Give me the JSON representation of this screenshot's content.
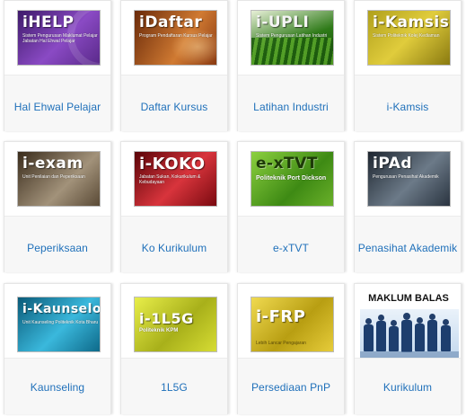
{
  "cards": [
    {
      "label": "Hal Ehwal Pelajar",
      "thumb_title": "iHELP",
      "thumb_sub": "Sistem Pengurusan Maklumat Pelajar Jabatan Hal Ehwal Pelajar",
      "colors": [
        "#5a2a8a",
        "#7d3fb0"
      ]
    },
    {
      "label": "Daftar Kursus",
      "thumb_title": "iDaftar",
      "thumb_sub": "Program Pendaftaran Kursus Pelajar",
      "colors": [
        "#8a3a12",
        "#c46a2a"
      ]
    },
    {
      "label": "Latihan Industri",
      "thumb_title": "i-UPLI",
      "thumb_sub": "Sistem Pengurusan Latihan Industri",
      "colors": [
        "#1f5e12",
        "#4f9a22"
      ]
    },
    {
      "label": "i-Kamsis",
      "thumb_title": "i-Kamsis",
      "thumb_sub": "Sistem Politeknik Kolej Kediaman",
      "colors": [
        "#8a7a10",
        "#c9b42a"
      ]
    },
    {
      "label": "Peperiksaan",
      "thumb_title": "i-exam",
      "thumb_sub": "Unit Penilaian dan Peperiksaan",
      "colors": [
        "#4a3a28",
        "#8a7a62"
      ]
    },
    {
      "label": "Ko Kurikulum",
      "thumb_title": "i-KOKO",
      "thumb_sub": "Jabatan Sukan, Kokurikulum & Kebudayaan",
      "colors": [
        "#7a0a10",
        "#c8242c"
      ]
    },
    {
      "label": "e-xTVT",
      "thumb_title": "e-xTVT",
      "thumb_sub": "Politeknik Port Dickson",
      "colors": [
        "#3e7a14",
        "#7ec23a"
      ]
    },
    {
      "label": "Penasihat Akademik",
      "thumb_title": "iPAd",
      "thumb_sub": "Pengurusan Penasihat Akademik",
      "colors": [
        "#2a3440",
        "#5c6a78"
      ]
    },
    {
      "label": "Kaunseling",
      "thumb_title": "i-Kaunselor",
      "thumb_sub": "Unit Kaunseling Politeknik Kota Bharu",
      "colors": [
        "#0e6a8a",
        "#2aa6c8"
      ]
    },
    {
      "label": "1L5G",
      "thumb_title": "i-1L5G",
      "thumb_sub": "Politeknik KPM",
      "colors": [
        "#9aa016",
        "#d6dc34"
      ]
    },
    {
      "label": "Persediaan PnP",
      "thumb_title": "i-FRP",
      "thumb_sub": "Lebih Lancar Pengajaran",
      "colors": [
        "#b09a10",
        "#e6cc3a"
      ]
    },
    {
      "label": "Kurikulum",
      "thumb_title": "MAKLUM BALAS",
      "thumb_sub": "",
      "colors": [
        "#ffffff",
        "#ffffff"
      ]
    }
  ]
}
